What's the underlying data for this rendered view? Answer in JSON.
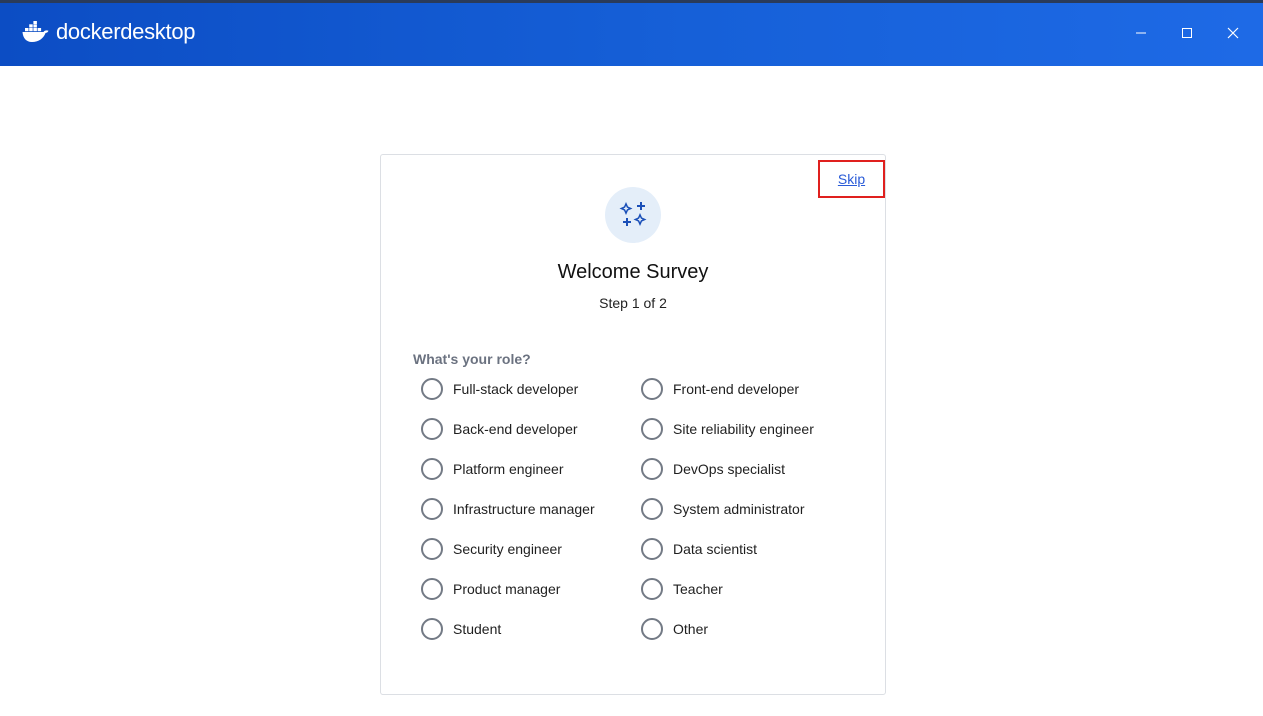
{
  "app": {
    "brand_part1": "docker",
    "brand_part2": "desktop",
    "window_controls": [
      "minimize-icon",
      "maximize-icon",
      "close-icon"
    ],
    "accent_color": "#1660d8"
  },
  "survey": {
    "skip_label": "Skip",
    "icon": "sparkles-icon",
    "title": "Welcome Survey",
    "step": "Step 1 of 2",
    "question": "What's your role?",
    "options_left": [
      "Full-stack developer",
      "Back-end developer",
      "Platform engineer",
      "Infrastructure manager",
      "Security engineer",
      "Product manager",
      "Student"
    ],
    "options_right": [
      "Front-end developer",
      "Site reliability engineer",
      "DevOps specialist",
      "System administrator",
      "Data scientist",
      "Teacher",
      "Other"
    ],
    "highlight_color": "#e0201e"
  }
}
